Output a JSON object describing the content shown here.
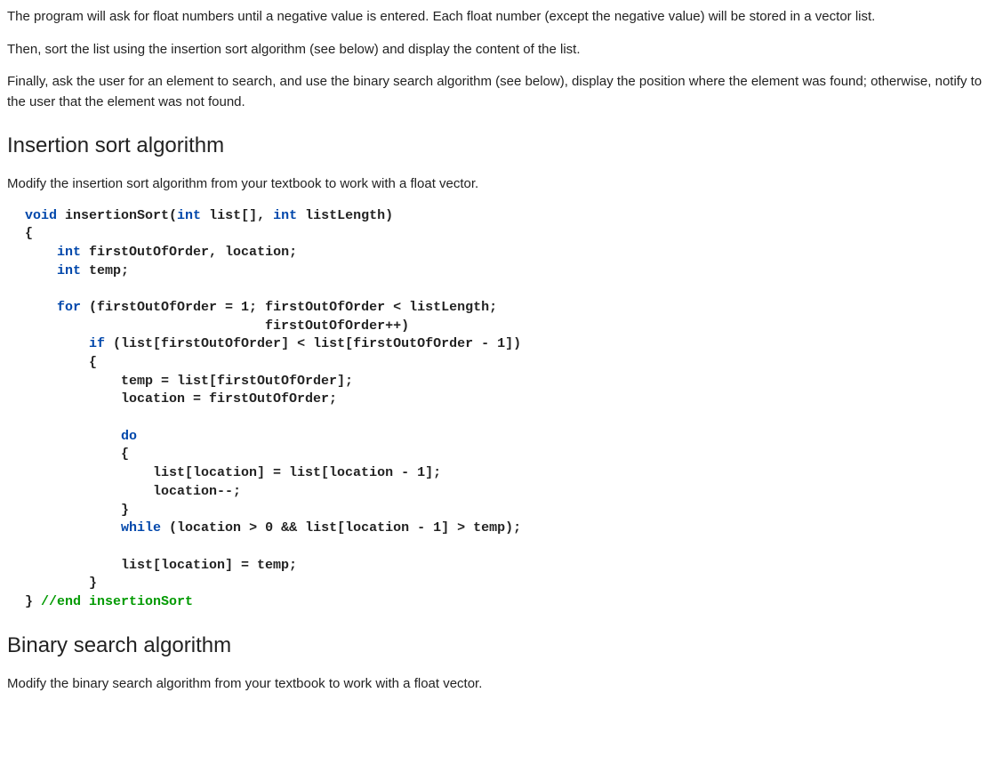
{
  "paragraphs": {
    "p1": "The program will ask for float numbers until a negative value is entered. Each float number (except the negative value) will be stored in a vector list.",
    "p2": "Then, sort the list using the insertion sort algorithm (see below) and display the content of the list.",
    "p3": "Finally, ask the user for an element to search, and use the binary search algorithm (see below), display the position where the element was found; otherwise, notify to the user that the element was not found.",
    "h_ins": "Insertion sort algorithm",
    "p4": "Modify the insertion sort algorithm from your textbook to work with a float vector.",
    "h_bin": "Binary search algorithm",
    "p5": "Modify the binary search algorithm from your textbook to work with a float vector."
  },
  "code": {
    "l01a": "void",
    "l01b": " insertionSort(",
    "l01c": "int",
    "l01d": " list[], ",
    "l01e": "int",
    "l01f": " listLength)",
    "l02": "{",
    "l03a": "    ",
    "l03b": "int",
    "l03c": " firstOutOfOrder, location;",
    "l04a": "    ",
    "l04b": "int",
    "l04c": " temp;",
    "blank1": "",
    "l05a": "    ",
    "l05b": "for",
    "l05c": " (firstOutOfOrder = 1; firstOutOfOrder < listLength;",
    "l06": "                              firstOutOfOrder++)",
    "l07a": "        ",
    "l07b": "if",
    "l07c": " (list[firstOutOfOrder] < list[firstOutOfOrder - 1])",
    "l08": "        {",
    "l09": "            temp = list[firstOutOfOrder];",
    "l10": "            location = firstOutOfOrder;",
    "blank2": "",
    "l11a": "            ",
    "l11b": "do",
    "l12": "            {",
    "l13": "                list[location] = list[location - 1];",
    "l14": "                location--;",
    "l15": "            }",
    "l16a": "            ",
    "l16b": "while",
    "l16c": " (location > 0 && list[location - 1] > temp);",
    "blank3": "",
    "l17": "            list[location] = temp;",
    "l18": "        }",
    "l19a": "} ",
    "l19b": "//",
    "l19c": "end insertionSort"
  }
}
